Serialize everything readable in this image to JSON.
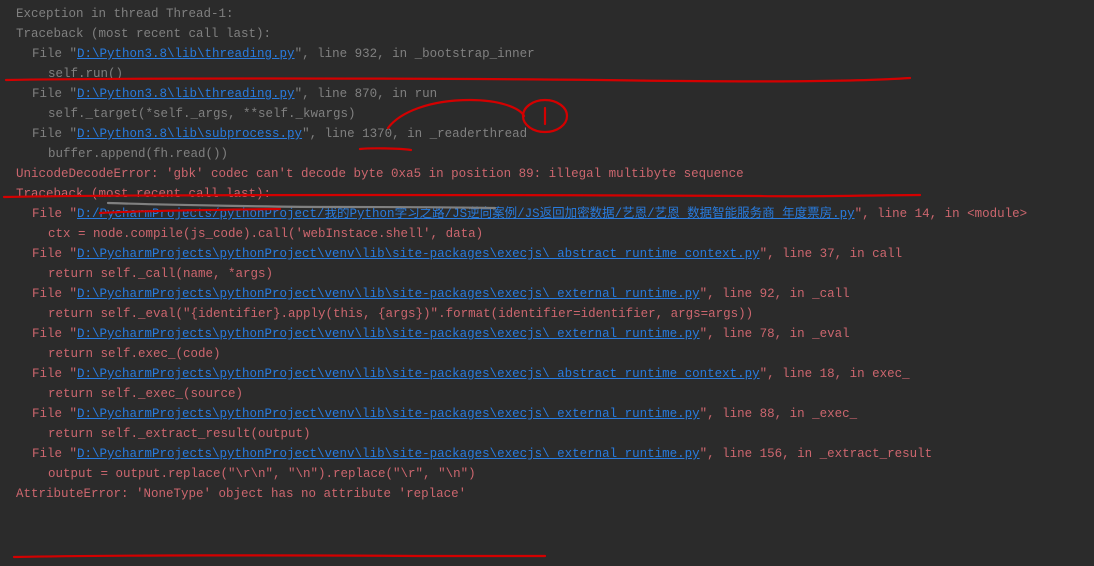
{
  "lines": [
    {
      "cls": "line",
      "parts": [
        {
          "t": "Exception in thread Thread-1:",
          "c": "gray"
        }
      ]
    },
    {
      "cls": "line",
      "parts": [
        {
          "t": "Traceback (most recent call last):",
          "c": "gray"
        }
      ]
    },
    {
      "cls": "line indent1",
      "parts": [
        {
          "t": "File \"",
          "c": "gray"
        },
        {
          "t": "D:\\Python3.8\\lib\\threading.py",
          "c": "blue",
          "link": true
        },
        {
          "t": "\", line 932, in _bootstrap_inner",
          "c": "gray"
        }
      ]
    },
    {
      "cls": "line indent2",
      "parts": [
        {
          "t": "self.run()",
          "c": "gray"
        }
      ]
    },
    {
      "cls": "line indent1",
      "parts": [
        {
          "t": "File \"",
          "c": "gray"
        },
        {
          "t": "D:\\Python3.8\\lib\\threading.py",
          "c": "blue",
          "link": true
        },
        {
          "t": "\", line 870, in run",
          "c": "gray"
        }
      ]
    },
    {
      "cls": "line indent2",
      "parts": [
        {
          "t": "self._target(*self._args, **self._kwargs)",
          "c": "gray"
        }
      ]
    },
    {
      "cls": "line indent1",
      "parts": [
        {
          "t": "File \"",
          "c": "gray"
        },
        {
          "t": "D:\\Python3.8\\lib\\subprocess.py",
          "c": "blue",
          "link": true
        },
        {
          "t": "\", line 1370, in _readerthread",
          "c": "gray"
        }
      ]
    },
    {
      "cls": "line indent2",
      "parts": [
        {
          "t": "buffer.append(fh.read())",
          "c": "gray"
        }
      ]
    },
    {
      "cls": "line",
      "parts": [
        {
          "t": "UnicodeDecodeError: 'gbk' codec can't decode byte 0xa5 in position 89: illegal multibyte sequence",
          "c": "red"
        }
      ]
    },
    {
      "cls": "line",
      "parts": [
        {
          "t": "Traceback (most recent call last):",
          "c": "red"
        }
      ]
    },
    {
      "cls": "line indent1",
      "parts": [
        {
          "t": "File \"",
          "c": "red"
        },
        {
          "t": "D:/PycharmProjects/pythonProject/我的Python学习之路/JS逆向案例/JS返回加密数据/艺恩/艺恩_数据智能服务商_年度票房.py",
          "c": "blue",
          "link": true
        },
        {
          "t": "\", line 14, in <module>",
          "c": "red"
        }
      ]
    },
    {
      "cls": "line indent2",
      "parts": [
        {
          "t": "ctx = node.compile(js_code).call('webInstace.shell', data)",
          "c": "red"
        }
      ]
    },
    {
      "cls": "line indent1",
      "parts": [
        {
          "t": "File \"",
          "c": "red"
        },
        {
          "t": "D:\\PycharmProjects\\pythonProject\\venv\\lib\\site-packages\\execjs\\_abstract_runtime_context.py",
          "c": "blue",
          "link": true
        },
        {
          "t": "\", line 37, in call",
          "c": "red"
        }
      ]
    },
    {
      "cls": "line indent2",
      "parts": [
        {
          "t": "return self._call(name, *args)",
          "c": "red"
        }
      ]
    },
    {
      "cls": "line indent1",
      "parts": [
        {
          "t": "File \"",
          "c": "red"
        },
        {
          "t": "D:\\PycharmProjects\\pythonProject\\venv\\lib\\site-packages\\execjs\\_external_runtime.py",
          "c": "blue",
          "link": true
        },
        {
          "t": "\", line 92, in _call",
          "c": "red"
        }
      ]
    },
    {
      "cls": "line indent2",
      "parts": [
        {
          "t": "return self._eval(\"{identifier}.apply(this, {args})\".format(identifier=identifier, args=args))",
          "c": "red"
        }
      ]
    },
    {
      "cls": "line indent1",
      "parts": [
        {
          "t": "File \"",
          "c": "red"
        },
        {
          "t": "D:\\PycharmProjects\\pythonProject\\venv\\lib\\site-packages\\execjs\\_external_runtime.py",
          "c": "blue",
          "link": true
        },
        {
          "t": "\", line 78, in _eval",
          "c": "red"
        }
      ]
    },
    {
      "cls": "line indent2",
      "parts": [
        {
          "t": "return self.exec_(code)",
          "c": "red"
        }
      ]
    },
    {
      "cls": "line indent1",
      "parts": [
        {
          "t": "File \"",
          "c": "red"
        },
        {
          "t": "D:\\PycharmProjects\\pythonProject\\venv\\lib\\site-packages\\execjs\\_abstract_runtime_context.py",
          "c": "blue",
          "link": true
        },
        {
          "t": "\", line 18, in exec_",
          "c": "red"
        }
      ]
    },
    {
      "cls": "line indent2",
      "parts": [
        {
          "t": "return self._exec_(source)",
          "c": "red"
        }
      ]
    },
    {
      "cls": "line indent1",
      "parts": [
        {
          "t": "File \"",
          "c": "red"
        },
        {
          "t": "D:\\PycharmProjects\\pythonProject\\venv\\lib\\site-packages\\execjs\\_external_runtime.py",
          "c": "blue",
          "link": true
        },
        {
          "t": "\", line 88, in _exec_",
          "c": "red"
        }
      ]
    },
    {
      "cls": "line indent2",
      "parts": [
        {
          "t": "return self._extract_result(output)",
          "c": "red"
        }
      ]
    },
    {
      "cls": "line indent1",
      "parts": [
        {
          "t": "File \"",
          "c": "red"
        },
        {
          "t": "D:\\PycharmProjects\\pythonProject\\venv\\lib\\site-packages\\execjs\\_external_runtime.py",
          "c": "blue",
          "link": true
        },
        {
          "t": "\", line 156, in _extract_result",
          "c": "red"
        }
      ]
    },
    {
      "cls": "line indent2",
      "parts": [
        {
          "t": "output = output.replace(\"\\r\\n\", \"\\n\").replace(\"\\r\", \"\\n\")",
          "c": "red"
        }
      ]
    },
    {
      "cls": "line",
      "parts": [
        {
          "t": "AttributeError: 'NoneType' object has no attribute 'replace'",
          "c": "red"
        }
      ]
    }
  ]
}
